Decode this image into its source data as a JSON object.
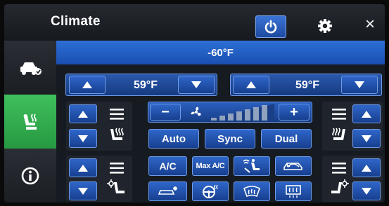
{
  "header": {
    "title": "Climate",
    "power_icon": "power-icon",
    "settings_icon": "gear-icon",
    "close_label": "×"
  },
  "sidebar": {
    "tabs": [
      {
        "id": "vehicle",
        "icon": "car-icon",
        "active": false
      },
      {
        "id": "seat",
        "icon": "seat-icon",
        "active": true
      },
      {
        "id": "info",
        "icon": "info-icon",
        "active": false
      }
    ]
  },
  "outside_temp": "-60°F",
  "zones": {
    "driver_temp": "59°F",
    "passenger_temp": "59°F"
  },
  "fan": {
    "minus_label": "−",
    "plus_label": "+",
    "level_fraction": 0
  },
  "modes": {
    "auto_label": "Auto",
    "sync_label": "Sync",
    "dual_label": "Dual",
    "ac_label": "A/C",
    "max_ac_label": "Max A/C"
  },
  "colors": {
    "accent": "#2f66c9",
    "active_tab": "#3fbf5c",
    "outside_bar": "#2d6fd6"
  }
}
